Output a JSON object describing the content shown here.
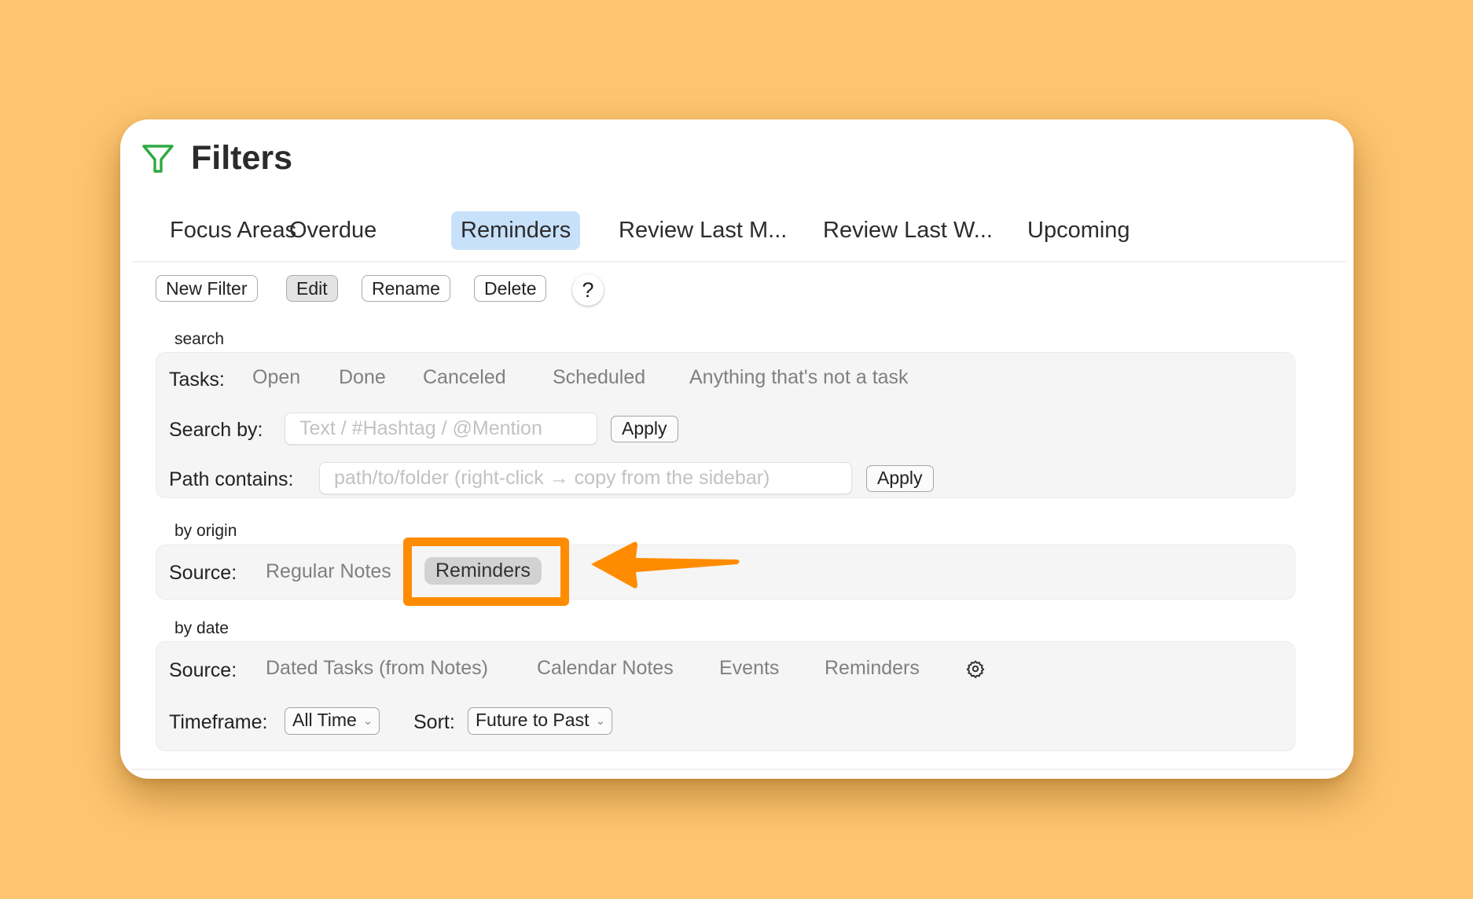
{
  "header": {
    "title": "Filters",
    "icon": "filter-funnel-icon",
    "icon_color": "#2daa3f"
  },
  "tabs": [
    {
      "label": "Focus Areas",
      "active": false
    },
    {
      "label": "Overdue",
      "active": false
    },
    {
      "label": "Reminders",
      "active": true
    },
    {
      "label": "Review Last M...",
      "active": false
    },
    {
      "label": "Review Last W...",
      "active": false
    },
    {
      "label": "Upcoming",
      "active": false
    }
  ],
  "toolbar": {
    "new_filter": "New Filter",
    "edit": "Edit",
    "rename": "Rename",
    "delete": "Delete",
    "help": "?"
  },
  "search": {
    "section_label": "search",
    "tasks_label": "Tasks:",
    "task_options": [
      "Open",
      "Done",
      "Canceled",
      "Scheduled",
      "Anything that's not a task"
    ],
    "search_by_label": "Search by:",
    "search_by_value": "",
    "search_by_placeholder": "Text / #Hashtag / @Mention",
    "search_apply": "Apply",
    "path_label": "Path contains:",
    "path_value": "",
    "path_placeholder": "path/to/folder (right-click → copy from the sidebar)",
    "path_apply": "Apply"
  },
  "by_origin": {
    "section_label": "by origin",
    "source_label": "Source:",
    "options": [
      {
        "label": "Regular Notes",
        "selected": false
      },
      {
        "label": "Reminders",
        "selected": true
      }
    ]
  },
  "by_date": {
    "section_label": "by date",
    "source_label": "Source:",
    "options": [
      "Dated Tasks (from Notes)",
      "Calendar Notes",
      "Events",
      "Reminders"
    ],
    "settings_icon": "gear-icon",
    "timeframe_label": "Timeframe:",
    "timeframe_value": "All Time",
    "sort_label": "Sort:",
    "sort_value": "Future to Past"
  },
  "annotation": {
    "color": "#ff8c00",
    "target": "Reminders"
  }
}
